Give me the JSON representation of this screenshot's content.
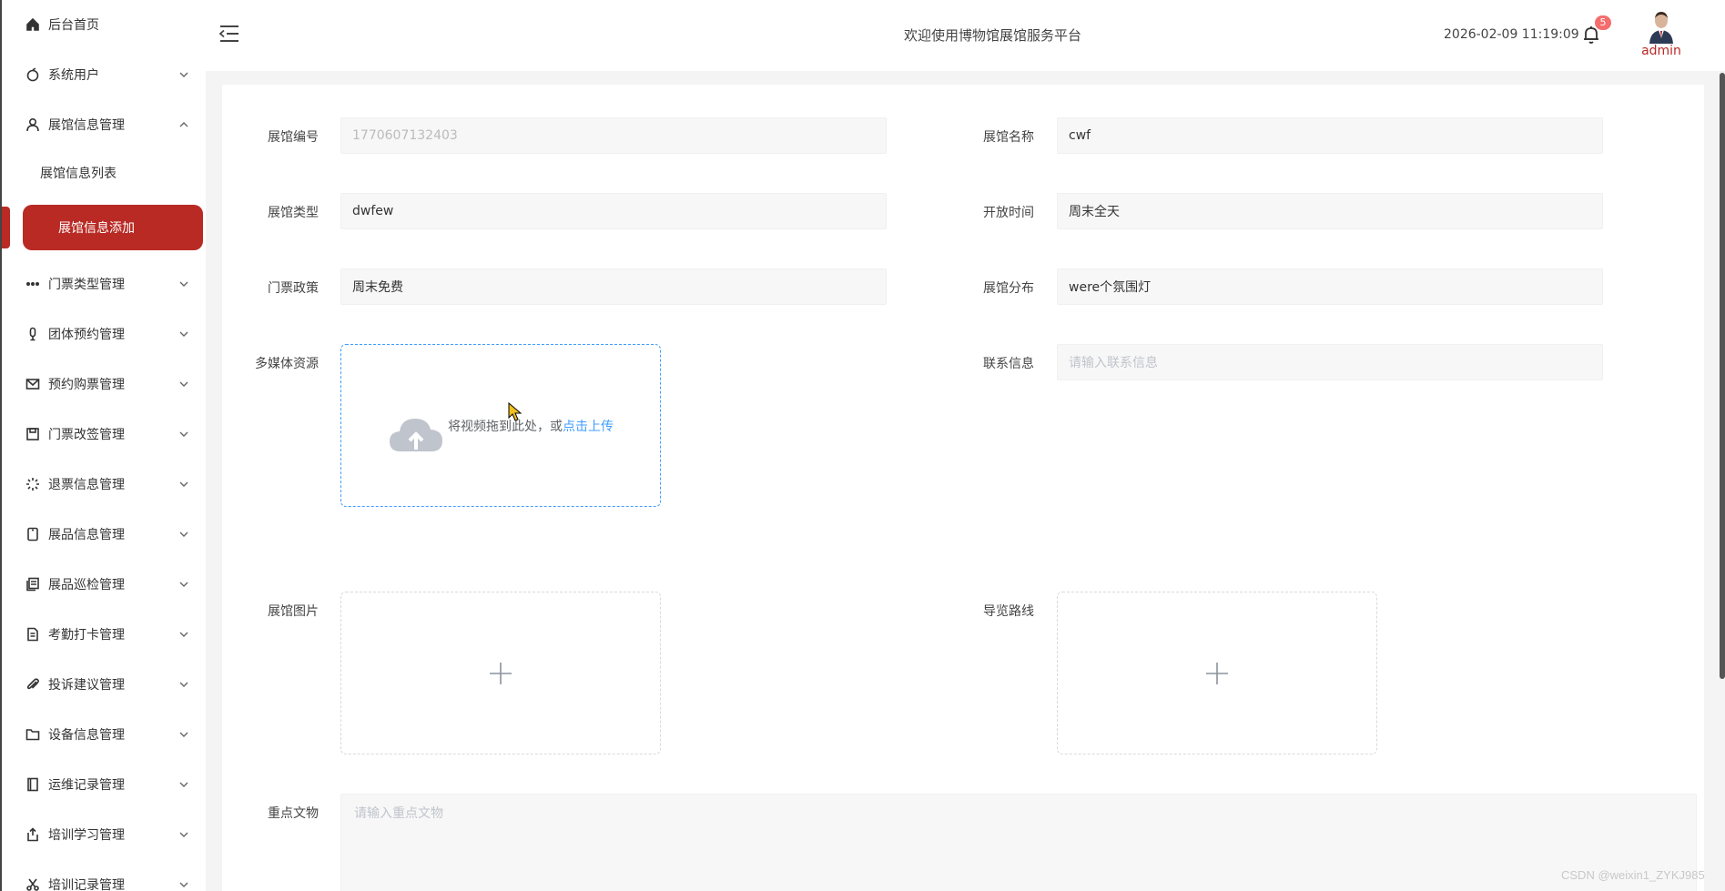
{
  "sidebar": {
    "items": [
      {
        "label": "后台首页",
        "icon": "home-icon"
      },
      {
        "label": "系统用户",
        "icon": "apple-icon"
      },
      {
        "label": "展馆信息管理",
        "icon": "user-icon"
      },
      {
        "label": "门票类型管理",
        "icon": "more-icon"
      },
      {
        "label": "团体预约管理",
        "icon": "mic-icon"
      },
      {
        "label": "预约购票管理",
        "icon": "mail-icon"
      },
      {
        "label": "门票改签管理",
        "icon": "save-icon"
      },
      {
        "label": "退票信息管理",
        "icon": "loading-icon"
      },
      {
        "label": "展品信息管理",
        "icon": "phone-icon"
      },
      {
        "label": "展品巡检管理",
        "icon": "copy-icon"
      },
      {
        "label": "考勤打卡管理",
        "icon": "document-icon"
      },
      {
        "label": "投诉建议管理",
        "icon": "paperclip-icon"
      },
      {
        "label": "设备信息管理",
        "icon": "folder-icon"
      },
      {
        "label": "运维记录管理",
        "icon": "notebook-icon"
      },
      {
        "label": "培训学习管理",
        "icon": "share-icon"
      },
      {
        "label": "培训记录管理",
        "icon": "cut-icon"
      }
    ],
    "sub_items": {
      "list": "展馆信息列表",
      "add": "展馆信息添加"
    }
  },
  "header": {
    "welcome": "欢迎使用博物馆展馆服务平台",
    "datetime": "2026-02-09 11:19:09",
    "notification_count": "5",
    "username": "admin"
  },
  "form": {
    "hall_no": {
      "label": "展馆编号",
      "value": "1770607132403"
    },
    "hall_name": {
      "label": "展馆名称",
      "value": "cwf"
    },
    "hall_type": {
      "label": "展馆类型",
      "value": "dwfew"
    },
    "open_time": {
      "label": "开放时间",
      "value": "周末全天"
    },
    "ticket_policy": {
      "label": "门票政策",
      "value": "周末免费"
    },
    "distribution": {
      "label": "展馆分布",
      "value": "were个氛围灯"
    },
    "media": {
      "label": "多媒体资源",
      "upload_text": "将视频拖到此处，或",
      "upload_link": "点击上传"
    },
    "contact": {
      "label": "联系信息",
      "placeholder": "请输入联系信息"
    },
    "hall_image": {
      "label": "展馆图片"
    },
    "guide_route": {
      "label": "导览路线"
    },
    "key_relics": {
      "label": "重点文物",
      "placeholder": "请输入重点文物"
    }
  },
  "watermark": "CSDN @weixin1_ZYKJ985",
  "colors": {
    "accent": "#b92a24",
    "link": "#409eff",
    "badge": "#f56c6c"
  }
}
